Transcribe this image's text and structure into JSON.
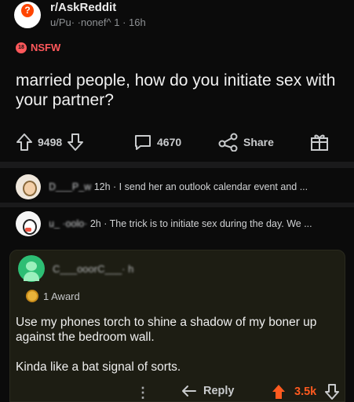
{
  "post": {
    "subreddit": "r/AskReddit",
    "author_meta": "u/Pu·  ·nonef^  1 · 16h",
    "nsfw_badge": "18",
    "nsfw_label": "NSFW",
    "title": "married people, how do you initiate sex with your partner?"
  },
  "actions": {
    "upvotes": "9498",
    "comments": "4670",
    "share_label": "Share"
  },
  "comments": [
    {
      "user": "D___P_w",
      "time": "12h",
      "preview": "I send her an outlook calendar event and ..."
    },
    {
      "user": "u_ ·oolo·",
      "time": "2h",
      "preview": "The trick is to initiate sex during the day. We ..."
    }
  ],
  "focused_comment": {
    "user": "C___ooorC___·  h",
    "award": "1 Award",
    "body": [
      "Use my phones torch to shine a shadow of my boner up against the bedroom wall.",
      "Kinda like a bat signal of sorts."
    ],
    "more": "⋮",
    "reply_label": "Reply",
    "score": "3.5k"
  },
  "colors": {
    "background": "#0b0b0b",
    "nsfw": "#ff585b",
    "upvote_active": "#ff5a1f",
    "comment_panel": "#1d1d13"
  }
}
